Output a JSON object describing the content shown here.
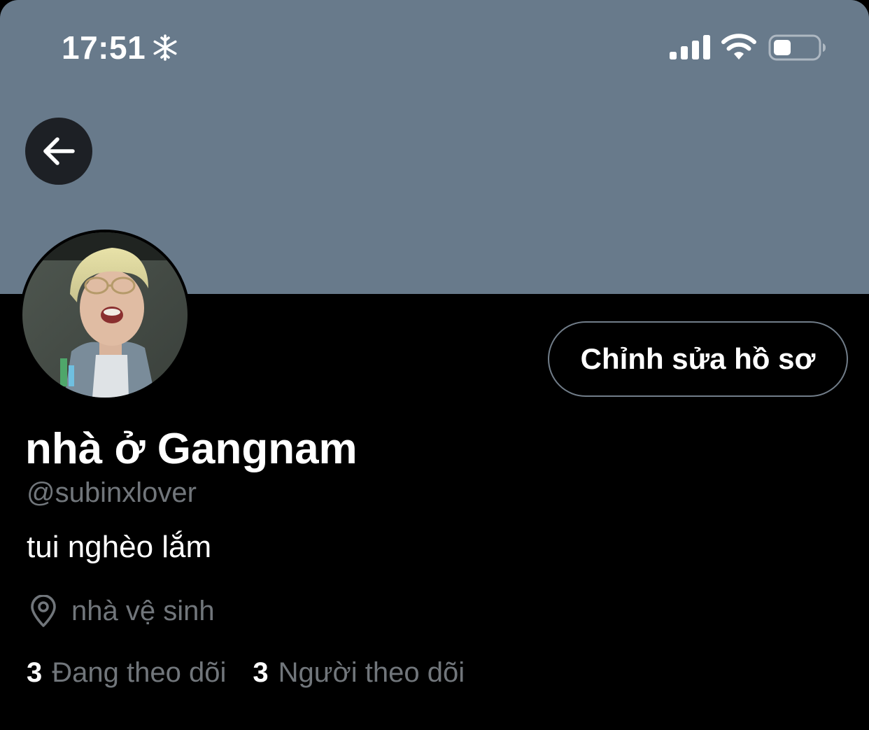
{
  "status_bar": {
    "time": "17:51",
    "indicator_icon": "snowflake-icon",
    "signal_icon": "cellular-signal-icon",
    "wifi_icon": "wifi-icon",
    "battery_icon": "battery-icon",
    "battery_level": 0.4
  },
  "header": {
    "banner_color": "#687a8b",
    "back_icon": "arrow-left-icon"
  },
  "profile": {
    "avatar_icon": "profile-photo",
    "edit_button_label": "Chỉnh sửa hồ sơ",
    "display_name": "nhà ở Gangnam",
    "handle": "@subinxlover",
    "bio": "tui nghèo lắm",
    "location_icon": "location-pin-icon",
    "location": "nhà vệ sinh",
    "following_count": "3",
    "following_label": "Đang theo dõi",
    "followers_count": "3",
    "followers_label": "Người theo dõi"
  }
}
